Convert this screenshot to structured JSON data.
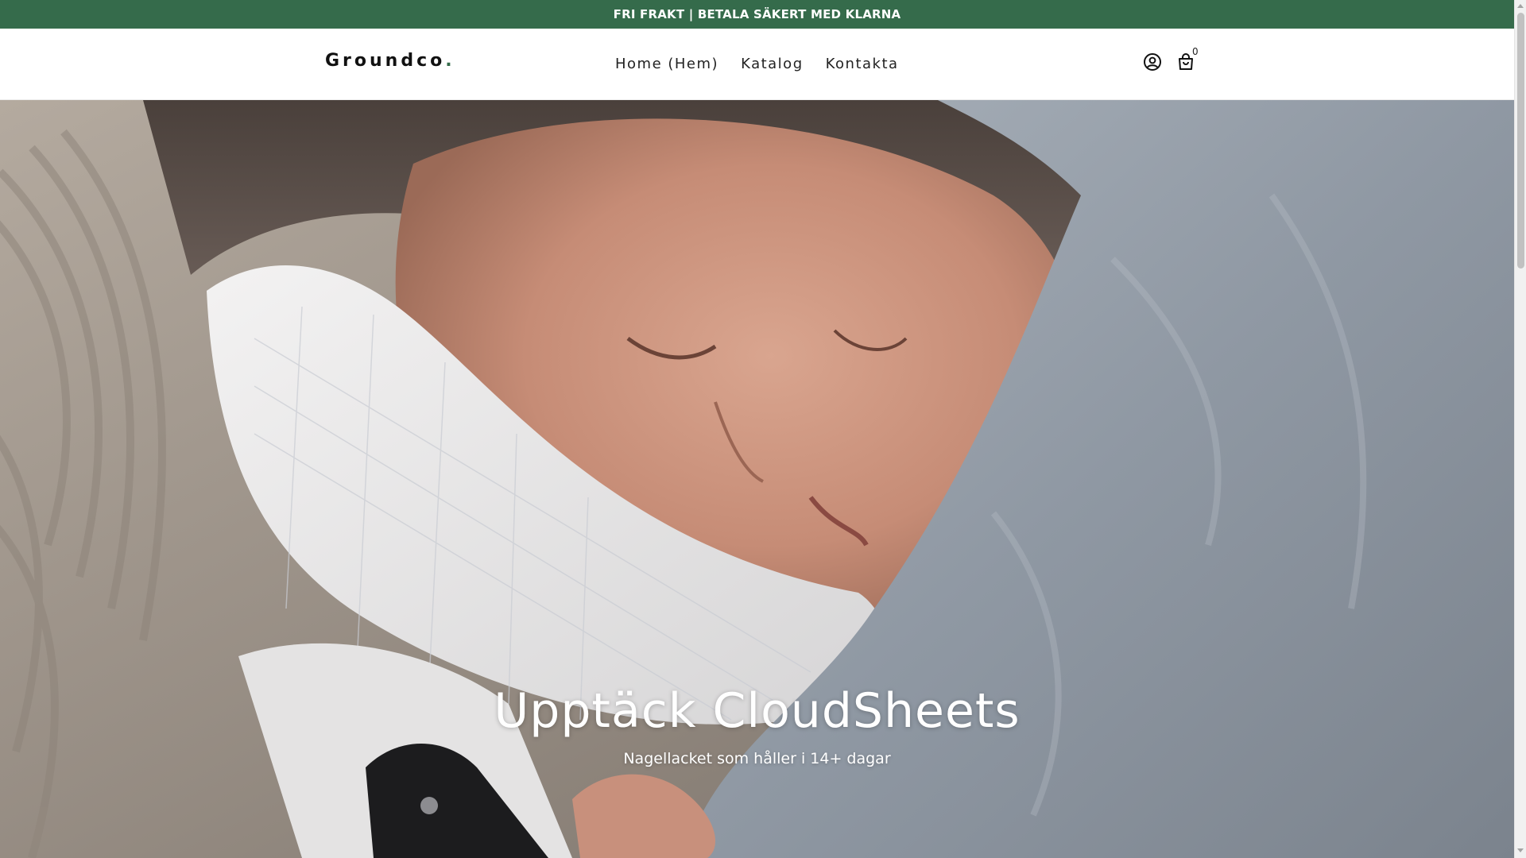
{
  "announcement": {
    "text": "FRI FRAKT | BETALA SÄKERT MED KLARNA"
  },
  "header": {
    "logo_text": "Groundco",
    "logo_dot": ".",
    "nav": [
      {
        "label": "Home (Hem)"
      },
      {
        "label": "Katalog"
      },
      {
        "label": "Kontakta"
      }
    ],
    "cart_count": "0",
    "icons": [
      "account-icon",
      "cart-icon"
    ]
  },
  "hero": {
    "title": "Upptäck CloudSheets",
    "subtitle": "Nagellacket som håller i 14+ dagar"
  },
  "colors": {
    "brand_green": "#356b4b",
    "text_dark": "#222222",
    "hero_text": "#ffffff"
  }
}
